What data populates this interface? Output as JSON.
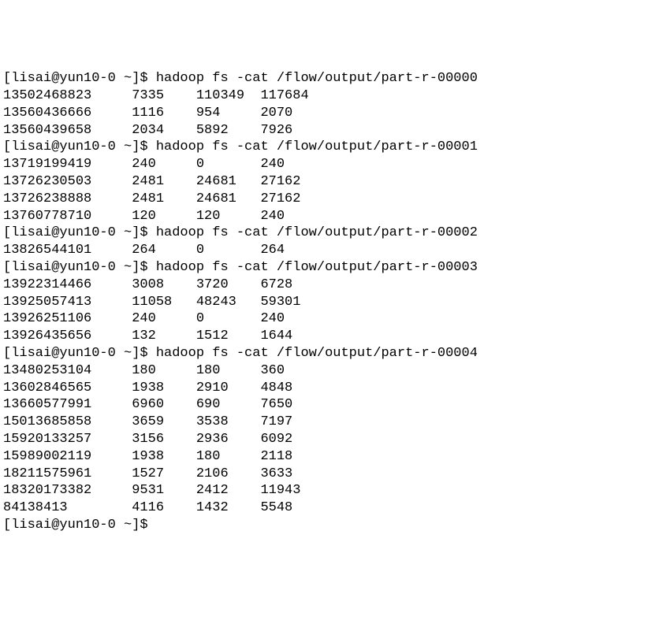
{
  "prompt_prefix": "[lisai@yun10-0 ~]$ ",
  "command_base": "hadoop fs -cat /flow/output/part-r-",
  "partial_prompt": "[lisai@yun10-0 ~]$",
  "sections": [
    {
      "part": "00000",
      "rows": [
        [
          "13502468823",
          "7335",
          "110349",
          "117684"
        ],
        [
          "13560436666",
          "1116",
          "954",
          "2070"
        ],
        [
          "13560439658",
          "2034",
          "5892",
          "7926"
        ]
      ]
    },
    {
      "part": "00001",
      "rows": [
        [
          "13719199419",
          "240",
          "0",
          "240"
        ],
        [
          "13726230503",
          "2481",
          "24681",
          "27162"
        ],
        [
          "13726238888",
          "2481",
          "24681",
          "27162"
        ],
        [
          "13760778710",
          "120",
          "120",
          "240"
        ]
      ]
    },
    {
      "part": "00002",
      "rows": [
        [
          "13826544101",
          "264",
          "0",
          "264"
        ]
      ]
    },
    {
      "part": "00003",
      "rows": [
        [
          "13922314466",
          "3008",
          "3720",
          "6728"
        ],
        [
          "13925057413",
          "11058",
          "48243",
          "59301"
        ],
        [
          "13926251106",
          "240",
          "0",
          "240"
        ],
        [
          "13926435656",
          "132",
          "1512",
          "1644"
        ]
      ]
    },
    {
      "part": "00004",
      "rows": [
        [
          "13480253104",
          "180",
          "180",
          "360"
        ],
        [
          "13602846565",
          "1938",
          "2910",
          "4848"
        ],
        [
          "13660577991",
          "6960",
          "690",
          "7650"
        ],
        [
          "15013685858",
          "3659",
          "3538",
          "7197"
        ],
        [
          "15920133257",
          "3156",
          "2936",
          "6092"
        ],
        [
          "15989002119",
          "1938",
          "180",
          "2118"
        ],
        [
          "18211575961",
          "1527",
          "2106",
          "3633"
        ],
        [
          "18320173382",
          "9531",
          "2412",
          "11943"
        ],
        [
          "84138413",
          "4116",
          "1432",
          "5548"
        ]
      ]
    }
  ]
}
